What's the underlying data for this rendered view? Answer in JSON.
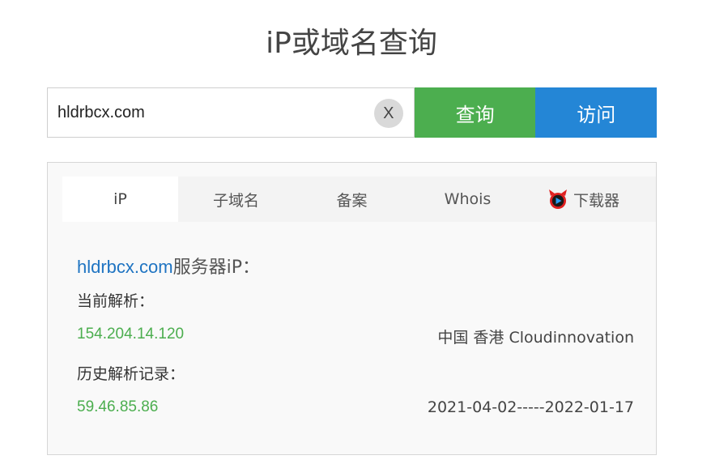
{
  "page": {
    "title": "iP或域名查询"
  },
  "search": {
    "value": "hldrbcx.com",
    "clear_label": "X",
    "query_label": "查询",
    "visit_label": "访问"
  },
  "tabs": [
    {
      "label": "iP",
      "active": true
    },
    {
      "label": "子域名"
    },
    {
      "label": "备案"
    },
    {
      "label": "Whois"
    },
    {
      "label": "下载器",
      "icon": "devil-logo-icon"
    }
  ],
  "result": {
    "domain": "hldrbcx.com",
    "domain_suffix": "服务器iP：",
    "current_label": "当前解析：",
    "current": {
      "ip": "154.204.14.120",
      "location": "中国 香港 Cloudinnovation"
    },
    "history_label": "历史解析记录：",
    "history": [
      {
        "ip": "59.46.85.86",
        "range": "2021-04-02-----2022-01-17"
      }
    ]
  },
  "colors": {
    "query_button": "#4cae4f",
    "visit_button": "#2486d6",
    "domain_link": "#1f74c2",
    "ip_text": "#4cae4f"
  }
}
